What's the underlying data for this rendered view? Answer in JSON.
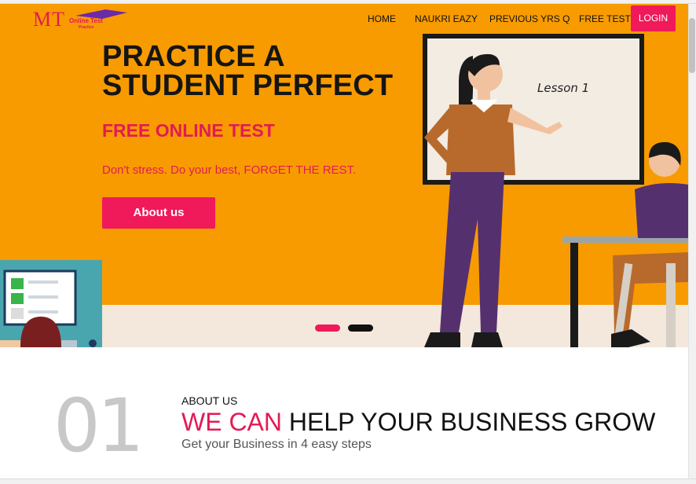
{
  "brand": {
    "logo_mark": "MT",
    "logo_line1": "Online Test",
    "logo_line2": "Practice"
  },
  "nav": {
    "items": [
      "HOME",
      "NAUKRI EAZY",
      "PREVIOUS YRS Q",
      "FREE TEST"
    ],
    "login_label": "LOGIN"
  },
  "hero": {
    "headline_line1": "PRACTICE A",
    "headline_line2": "STUDENT PERFECT",
    "subheadline": "FREE ONLINE TEST",
    "tagline": "Don't stress. Do your best, FORGET THE REST.",
    "cta_label": "About us",
    "board_text": "Lesson 1",
    "slide_count": 2,
    "active_slide": 1
  },
  "section": {
    "number": "01",
    "kicker": "ABOUT US",
    "title_highlight": "WE CAN",
    "title_rest": "HELP YOUR BUSINESS GROW",
    "subtitle": "Get your Business in 4 easy steps"
  },
  "colors": {
    "hero_bg": "#f89b00",
    "accent": "#f0195a",
    "headline": "#151515"
  }
}
